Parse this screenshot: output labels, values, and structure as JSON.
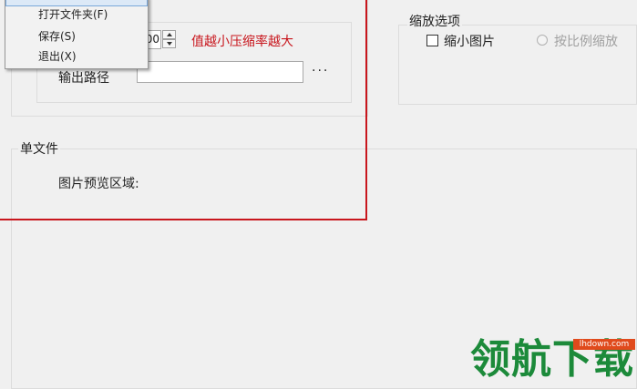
{
  "menu": {
    "items": [
      {
        "label": "打开文件夹(F)"
      },
      {
        "label": "保存(S)"
      },
      {
        "label": "退出(X)"
      }
    ]
  },
  "output": {
    "quality_value": "00",
    "hint": "值越小压缩率越大",
    "path_label": "输出路径",
    "path_value": "",
    "browse_label": "···"
  },
  "scale": {
    "title": "缩放选项",
    "shrink_label": "缩小图片",
    "shrink_checked": false,
    "ratio_label": "按比例缩放",
    "ratio_enabled": false
  },
  "single": {
    "title": "单文件",
    "preview_label": "图片预览区域:"
  },
  "watermark": {
    "text": "领航下载",
    "url": "lhdown.com"
  },
  "colors": {
    "highlight_frame": "#c8161d",
    "hint_text": "#c8161d",
    "watermark_green": "#1c8a3a",
    "watermark_badge": "#e04a1c"
  }
}
